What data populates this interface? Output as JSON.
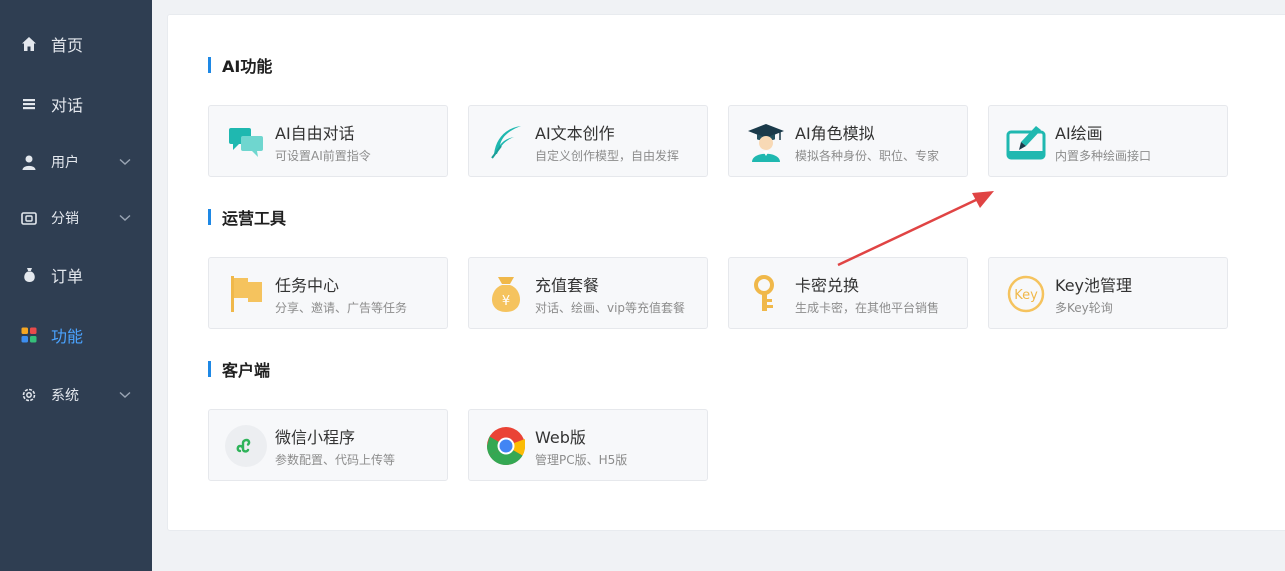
{
  "sidebar": {
    "items": [
      {
        "label": "首页",
        "icon": "home-icon"
      },
      {
        "label": "对话",
        "icon": "list-icon"
      },
      {
        "label": "用户",
        "icon": "user-icon",
        "expandable": true
      },
      {
        "label": "分销",
        "icon": "wallet-icon",
        "expandable": true
      },
      {
        "label": "订单",
        "icon": "money-bag-icon"
      },
      {
        "label": "功能",
        "icon": "apps-icon",
        "active": true
      },
      {
        "label": "系统",
        "icon": "gear-icon",
        "expandable": true
      }
    ]
  },
  "sections": [
    {
      "title": "AI功能",
      "cards": [
        {
          "title": "AI自由对话",
          "desc": "可设置AI前置指令",
          "icon": "chat-bubbles-icon"
        },
        {
          "title": "AI文本创作",
          "desc": "自定义创作模型，自由发挥",
          "icon": "feather-icon"
        },
        {
          "title": "AI角色模拟",
          "desc": "模拟各种身份、职位、专家",
          "icon": "graduate-icon"
        },
        {
          "title": "AI绘画",
          "desc": "内置多种绘画接口",
          "icon": "paint-icon"
        }
      ]
    },
    {
      "title": "运营工具",
      "cards": [
        {
          "title": "任务中心",
          "desc": "分享、邀请、广告等任务",
          "icon": "flag-icon"
        },
        {
          "title": "充值套餐",
          "desc": "对话、绘画、vip等充值套餐",
          "icon": "money-bag-icon"
        },
        {
          "title": "卡密兑换",
          "desc": "生成卡密，在其他平台销售",
          "icon": "key-icon"
        },
        {
          "title": "Key池管理",
          "desc": "多Key轮询",
          "icon": "key-badge-icon",
          "badge": "Key"
        }
      ]
    },
    {
      "title": "客户端",
      "cards": [
        {
          "title": "微信小程序",
          "desc": "参数配置、代码上传等",
          "icon": "mini-program-icon"
        },
        {
          "title": "Web版",
          "desc": "管理PC版、H5版",
          "icon": "chrome-icon"
        }
      ]
    }
  ],
  "colors": {
    "sidebar_bg": "#2f3e52",
    "active": "#4aa3ff",
    "accent_bar": "#1e88e5",
    "teal": "#1fb8b0",
    "yellow": "#f5c35e",
    "annotation_arrow": "#e04444"
  }
}
